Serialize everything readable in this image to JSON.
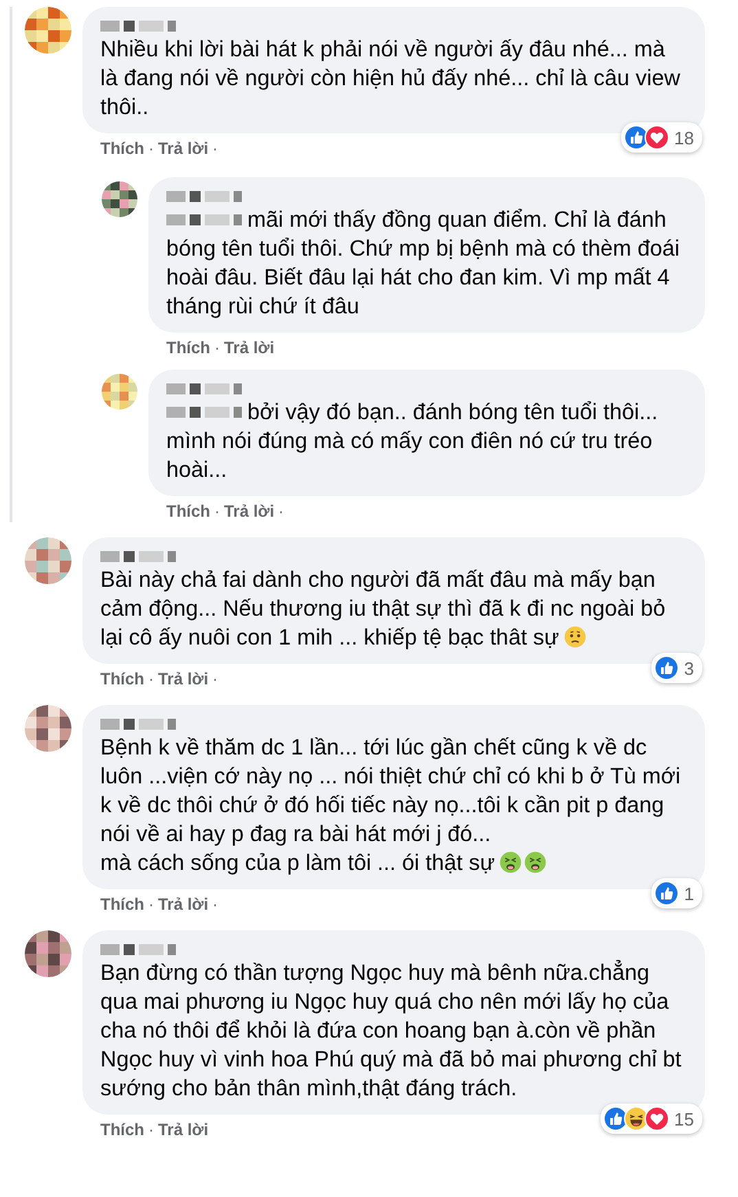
{
  "comments": [
    {
      "mention": false,
      "text": "Nhiều khi lời bài hát k phải nói về người ấy đâu nhé... mà là đang nói về người còn hiện hủ đấy nhé... chỉ là câu view thôi..",
      "actions": [
        {
          "kind": "link",
          "text": "Thích"
        },
        {
          "kind": "separator",
          "text": "·"
        },
        {
          "kind": "link",
          "text": "Trả lời"
        },
        {
          "kind": "separator",
          "text": "·"
        }
      ],
      "reactions": {
        "icons": [
          {
            "kind": "like"
          },
          {
            "kind": "love"
          }
        ],
        "count": "18"
      },
      "children": [
        {
          "mention": true,
          "text": "mãi mới thấy đồng quan điểm. Chỉ là đánh bóng tên tuổi thôi. Chứ mp bị bệnh mà có thèm đoái hoài đâu. Biết đâu lại hát cho đan kim. Vì mp mất 4 tháng rùi chứ ít đâu",
          "actions": [
            {
              "kind": "link",
              "text": "Thích"
            },
            {
              "kind": "separator",
              "text": "·"
            },
            {
              "kind": "link",
              "text": "Trả lời"
            }
          ]
        },
        {
          "mention": true,
          "text": "bởi vậy đó bạn.. đánh bóng tên tuổi thôi... mình nói đúng mà có mấy con điên nó cứ tru tréo hoài...",
          "actions": [
            {
              "kind": "link",
              "text": "Thích"
            },
            {
              "kind": "separator",
              "text": "·"
            },
            {
              "kind": "link",
              "text": "Trả lời"
            },
            {
              "kind": "separator",
              "text": "·"
            }
          ]
        }
      ]
    },
    {
      "mention": false,
      "text": "Bài này chả fai dành cho người đã mất đâu mà mấy bạn cảm động... Nếu thương iu thật sự thì đã k đi nc ngoài bỏ lại cô ấy nuôi con 1 mih ... khiếp tệ bạc thât sự",
      "emojis": [
        {
          "kind": "worried"
        }
      ],
      "actions": [
        {
          "kind": "link",
          "text": "Thích"
        },
        {
          "kind": "separator",
          "text": "·"
        },
        {
          "kind": "link",
          "text": "Trả lời"
        },
        {
          "kind": "separator",
          "text": "·"
        }
      ],
      "reactions": {
        "icons": [
          {
            "kind": "like"
          }
        ],
        "count": "3"
      }
    },
    {
      "mention": false,
      "text": "Bệnh k về thăm dc 1 lần... tới lúc gần chết cũng k về dc luôn ...viện cớ này nọ ... nói thiệt chứ chỉ có khi b ở Tù mới k về dc thôi chứ ở đó hối tiếc này nọ...tôi k cần pit p đang nói về ai hay p đag ra bài hát mới j đó...\nmà cách sống của p làm tôi ... ói thật sự",
      "emojis": [
        {
          "kind": "nauseated"
        },
        {
          "kind": "nauseated"
        }
      ],
      "actions": [
        {
          "kind": "link",
          "text": "Thích"
        },
        {
          "kind": "separator",
          "text": "·"
        },
        {
          "kind": "link",
          "text": "Trả lời"
        },
        {
          "kind": "separator",
          "text": "·"
        }
      ],
      "reactions": {
        "icons": [
          {
            "kind": "like"
          }
        ],
        "count": "1"
      }
    },
    {
      "mention": false,
      "text": "Bạn đừng có thần tượng Ngọc huy mà bênh nữa.chẳng qua mai phương iu Ngọc huy quá cho nên mới lấy họ của cha nó thôi để khỏi là đứa con hoang bạn à.còn về phần Ngọc huy vì vinh hoa Phú quý mà đã bỏ mai phương chỉ bt sướng cho bản thân mình,thật đáng trách.",
      "actions": [
        {
          "kind": "link",
          "text": "Thích"
        },
        {
          "kind": "separator",
          "text": "·"
        },
        {
          "kind": "link",
          "text": "Trả lời"
        }
      ],
      "reactions": {
        "icons": [
          {
            "kind": "like"
          },
          {
            "kind": "haha"
          },
          {
            "kind": "love"
          }
        ],
        "count": "15"
      }
    }
  ]
}
